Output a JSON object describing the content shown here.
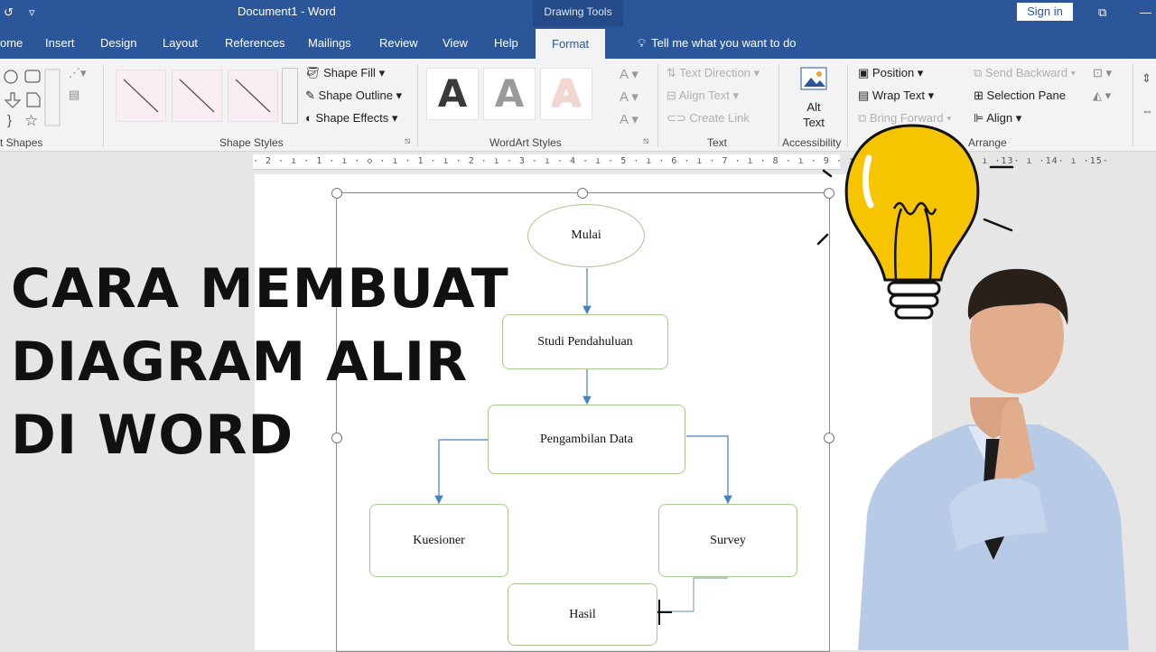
{
  "window": {
    "title": "Document1 - Word",
    "context_tab_group": "Drawing Tools",
    "sign_in_label": "Sign in"
  },
  "tabs": [
    "ome",
    "Insert",
    "Design",
    "Layout",
    "References",
    "Mailings",
    "Review",
    "View",
    "Help"
  ],
  "active_tab": "Format",
  "tell_me": "Tell me what you want to do",
  "ribbon": {
    "insert_shapes_label": "t Shapes",
    "shape_styles_label": "Shape Styles",
    "shape_fill": "Shape Fill",
    "shape_outline": "Shape Outline",
    "shape_effects": "Shape Effects",
    "wordart_label": "WordArt Styles",
    "wordart_letter": "A",
    "text_label": "Text",
    "text_direction": "Text Direction",
    "align_text": "Align Text",
    "create_link": "Create Link",
    "accessibility_label": "Accessibility",
    "alt_text_line1": "Alt",
    "alt_text_line2": "Text",
    "arrange_label": "Arrange",
    "position": "Position",
    "wrap_text": "Wrap Text",
    "bring_forward": "Bring Forward",
    "send_backward": "Send Backward",
    "selection_pane": "Selection Pane",
    "align": "Align"
  },
  "ruler_text": "· 2 · ı · 1 · ı · ◇ · ı · 1 · ı · 2 · ı · 3 · ı · 4 · ı · 5 · ı · 6 · ı · 7 · ı · 8 · ı · 9 · ı ·10· ı ·11· ı ·12· ı ·13· ı ·14· ı ·15·",
  "flowchart": {
    "start": "Mulai",
    "step1": "Studi Pendahuluan",
    "step2": "Pengambilan Data",
    "branch_left": "Kuesioner",
    "branch_right": "Survey",
    "end": "Hasil"
  },
  "headline": [
    "CARA MEMBUAT",
    "DIAGRAM ALIR",
    "DI WORD"
  ],
  "colors": {
    "word_blue": "#2b579a",
    "node_border": "#a8c98a",
    "connector": "#4a7fc1",
    "bulb": "#f7c400"
  }
}
